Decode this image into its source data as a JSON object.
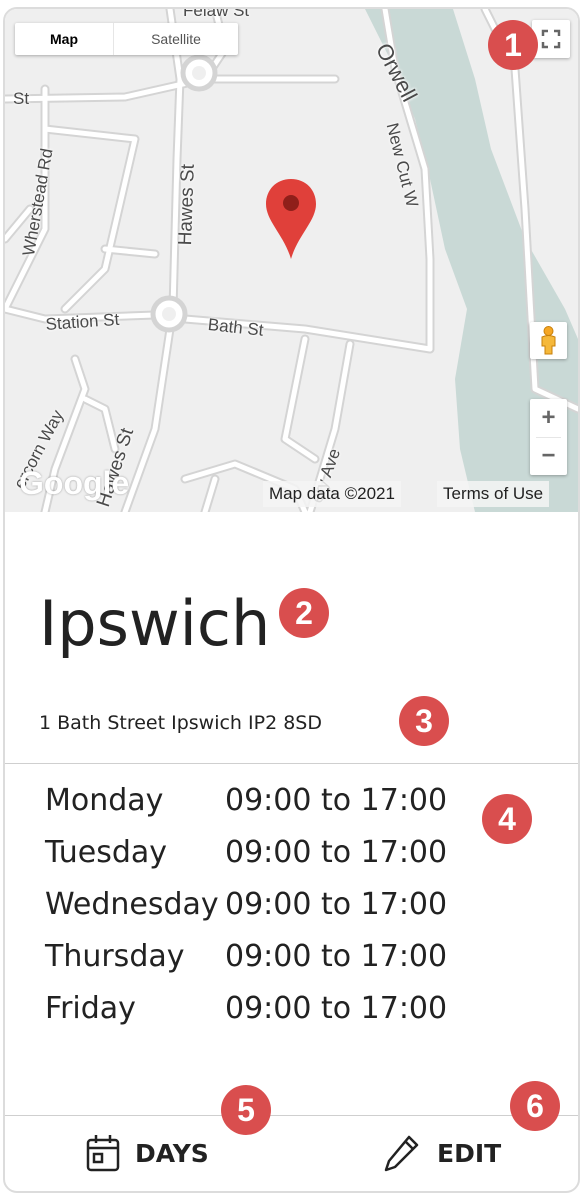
{
  "map": {
    "type_map": "Map",
    "type_satellite": "Satellite",
    "attribution": "Map data ©2021",
    "terms": "Terms of Use",
    "logo": "Google",
    "labels": {
      "orwell": "Orwell",
      "st_fragment": "St",
      "wherstead": "Wherstead Rd",
      "hawes_st_upper": "Hawes St",
      "new_cut": "New Cut W",
      "station_st": "Station St",
      "bath_st": "Bath St",
      "hawes_st_lower": "Hawes St",
      "felaw": "Felaw St",
      "percorn": "ercorn Way",
      "avenue": "ery Ave"
    },
    "zoom_in": "+",
    "zoom_out": "−"
  },
  "location": {
    "title": "Ipswich",
    "address": "1 Bath Street Ipswich IP2 8SD"
  },
  "hours": [
    {
      "day": "Monday",
      "time": "09:00 to 17:00"
    },
    {
      "day": "Tuesday",
      "time": "09:00 to 17:00"
    },
    {
      "day": "Wednesday",
      "time": "09:00 to 17:00"
    },
    {
      "day": "Thursday",
      "time": "09:00 to 17:00"
    },
    {
      "day": "Friday",
      "time": "09:00 to 17:00"
    }
  ],
  "footer": {
    "days_label": "DAYS",
    "edit_label": "EDIT"
  },
  "badges": [
    "1",
    "2",
    "3",
    "4",
    "5",
    "6"
  ],
  "colors": {
    "badge": "#d94e4e",
    "river": "#c9d9d6",
    "pin": "#e0403a"
  },
  "icons": [
    "fullscreen-icon",
    "pegman-icon",
    "map-pin-icon",
    "calendar-icon",
    "pencil-icon"
  ]
}
